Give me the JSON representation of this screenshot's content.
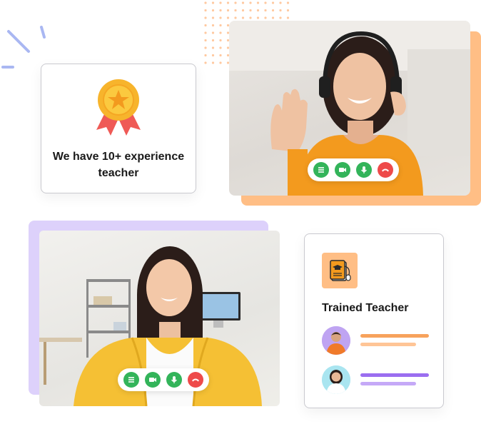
{
  "award_card": {
    "text": "We have 10+ experience teacher",
    "icon": "award-ribbon-icon"
  },
  "video_call_1": {
    "controls": [
      {
        "name": "chat-icon",
        "color": "#33b45a"
      },
      {
        "name": "camera-icon",
        "color": "#33b45a"
      },
      {
        "name": "microphone-icon",
        "color": "#33b45a"
      },
      {
        "name": "end-call-icon",
        "color": "#ee4a4a"
      }
    ]
  },
  "video_call_2": {
    "controls": [
      {
        "name": "chat-icon",
        "color": "#33b45a"
      },
      {
        "name": "camera-icon",
        "color": "#33b45a"
      },
      {
        "name": "microphone-icon",
        "color": "#33b45a"
      },
      {
        "name": "end-call-icon",
        "color": "#ee4a4a"
      }
    ]
  },
  "teacher_card": {
    "title": "Trained Teacher",
    "icon": "book-icon",
    "teachers": [
      {
        "avatar": "teacher-avatar-1",
        "accent": "#f7a25c"
      },
      {
        "avatar": "teacher-avatar-2",
        "accent": "#9b6ef0"
      }
    ]
  },
  "colors": {
    "orange_accent": "#ffbe85",
    "purple_accent": "#ddd1fb",
    "call_green": "#33b45a",
    "call_red": "#ee4a4a"
  }
}
